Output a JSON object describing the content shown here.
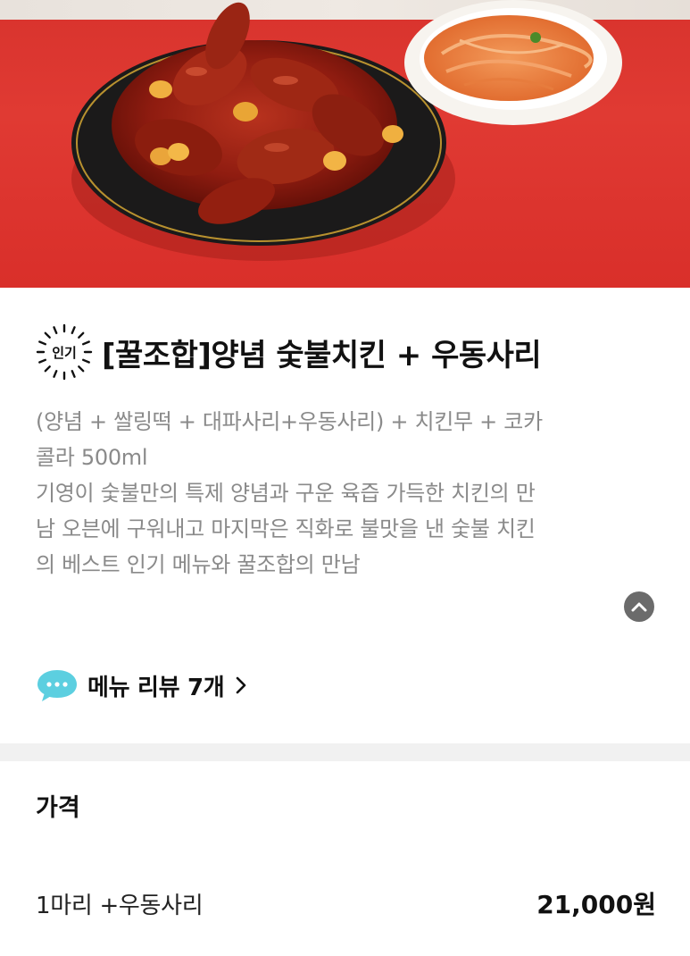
{
  "hero": {
    "image_alt": "양념 숯불치킨 + 우동사리"
  },
  "menu": {
    "badge_label": "인기",
    "title": "[꿀조합]양념 숯불치킨 + 우동사리",
    "description_lines": [
      "(양념 + 쌀링떡 + 대파사리+우동사리) + 치킨무 + 코카",
      "콜라 500ml",
      "기영이 숯불만의 특제 양념과 구운 육즙 가득한 치킨의 만",
      "남 오븐에 구워내고 마지막은 직화로 불맛을 낸 숯불 치킨",
      "의 베스트 인기 메뉴와 꿀조합의 만남"
    ]
  },
  "review": {
    "label": "메뉴 리뷰 7개"
  },
  "price": {
    "heading": "가격",
    "option_label": "1마리 +우동사리",
    "option_price": "21,000원"
  },
  "icons": {
    "badge": "popular-badge-icon",
    "collapse": "chevron-up-icon",
    "review": "speech-bubble-icon",
    "review_arrow": "chevron-right-icon"
  },
  "colors": {
    "hero_red": "#dd352f",
    "description_gray": "#8a8a8a",
    "review_bubble": "#5ccfe0",
    "divider": "#f1f1f1"
  }
}
